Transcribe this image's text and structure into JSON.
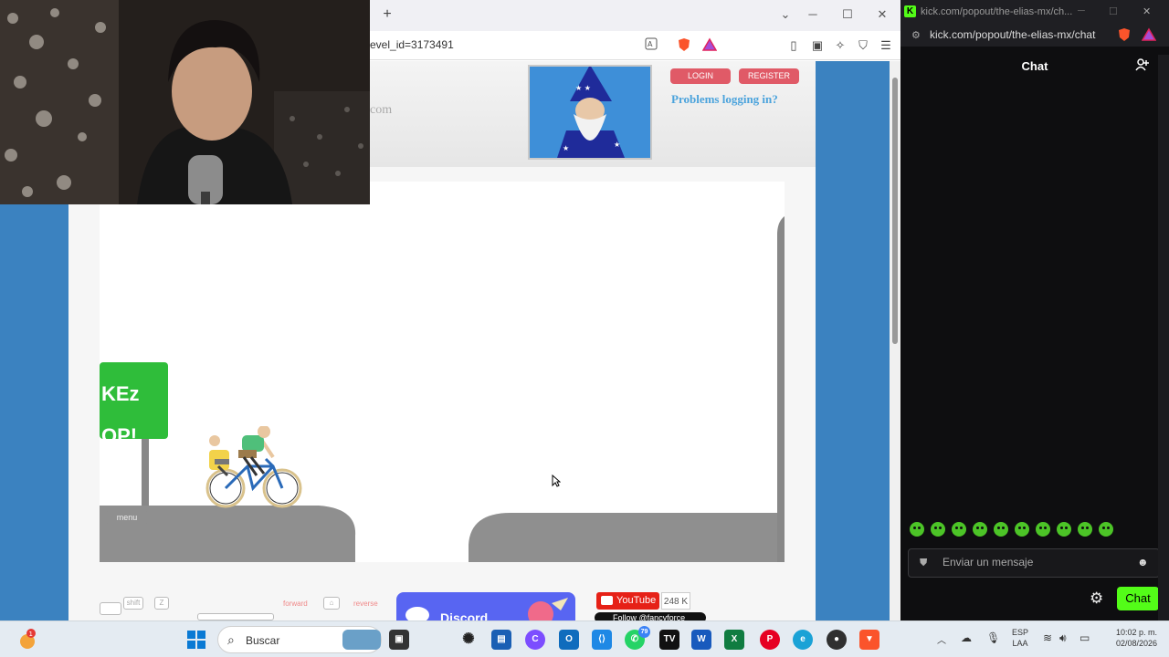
{
  "browser": {
    "new_tab_glyph": "+",
    "url_fragment": "evel_id=3173491",
    "window_controls": {
      "minimize": "─",
      "maximize": "☐",
      "close": "✕",
      "chevron": "⌄"
    }
  },
  "site": {
    "domain_fragment": "com",
    "login_label": "LOGIN",
    "register_label": "REGISTER",
    "problems_link": "Problems logging in?"
  },
  "game": {
    "sign_line1": "KEz",
    "sign_line2": "OP!",
    "menu_label": "menu"
  },
  "controls_legend": {
    "shift": "shift",
    "z": "Z",
    "forward": "forward",
    "reverse": "reverse"
  },
  "social": {
    "discord_label": "Discord",
    "youtube_label": "YouTube",
    "youtube_count": "248 K",
    "twitter_label": "Follow @fancyforce"
  },
  "chat": {
    "titlebar_url": "kick.com/popout/the-elias-mx/ch...",
    "favicon_letter": "K",
    "url": "kick.com/popout/the-elias-mx/chat",
    "header": "Chat",
    "input_placeholder": "Enviar un mensaje",
    "send_label": "Chat",
    "emote_count": 10
  },
  "taskbar": {
    "search_label": "Buscar",
    "lang_line1": "ESP",
    "lang_line2": "LAA",
    "time": "10:02 p. m.",
    "date": "02/08/2026",
    "whatsapp_badge": "79",
    "notification_badge": "1"
  },
  "colors": {
    "kick_green": "#53fc18",
    "page_blue": "#3b82c0",
    "login_red": "#e05a67",
    "sign_green": "#2fbd3a"
  }
}
